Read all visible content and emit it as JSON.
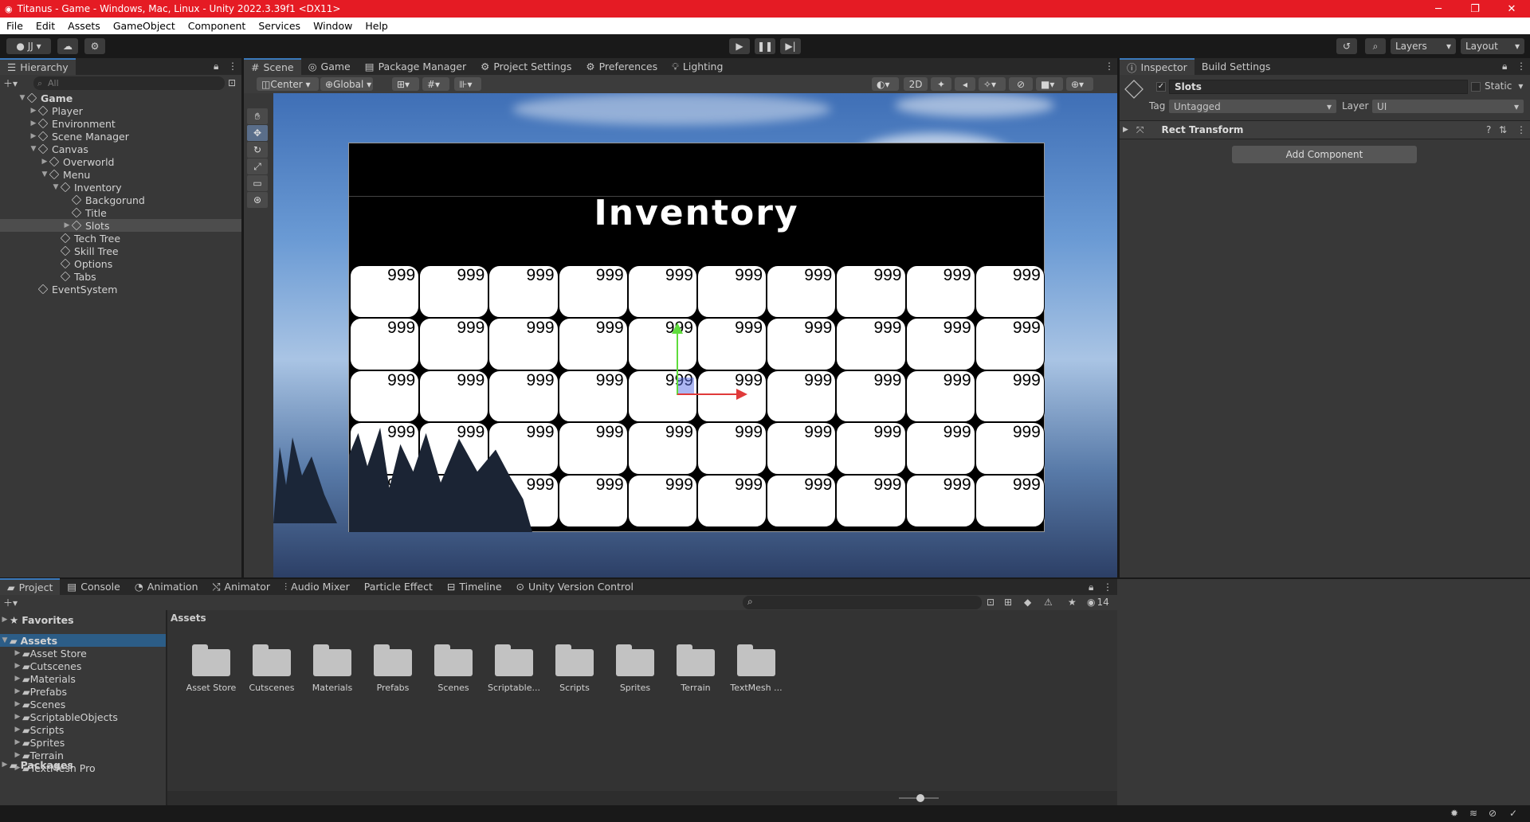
{
  "window": {
    "title": "Titanus - Game - Windows, Mac, Linux - Unity 2022.3.39f1 <DX11>",
    "minimize": "─",
    "maximize": "❐",
    "close": "✕"
  },
  "menu": [
    "File",
    "Edit",
    "Assets",
    "GameObject",
    "Component",
    "Services",
    "Window",
    "Help"
  ],
  "toolbar": {
    "account": "JJ",
    "layers": "Layers",
    "layout": "Layout"
  },
  "hierarchy": {
    "tab": "Hierarchy",
    "search_placeholder": "All",
    "rows": [
      {
        "label": "Game",
        "indent": 0,
        "arrow": "▼",
        "bold": true
      },
      {
        "label": "Player",
        "indent": 1,
        "arrow": "▶"
      },
      {
        "label": "Environment",
        "indent": 1,
        "arrow": "▶"
      },
      {
        "label": "Scene Manager",
        "indent": 1,
        "arrow": "▶"
      },
      {
        "label": "Canvas",
        "indent": 1,
        "arrow": "▼"
      },
      {
        "label": "Overworld",
        "indent": 2,
        "arrow": "▶"
      },
      {
        "label": "Menu",
        "indent": 2,
        "arrow": "▼"
      },
      {
        "label": "Inventory",
        "indent": 3,
        "arrow": "▼"
      },
      {
        "label": "Backgorund",
        "indent": 4,
        "arrow": ""
      },
      {
        "label": "Title",
        "indent": 4,
        "arrow": ""
      },
      {
        "label": "Slots",
        "indent": 4,
        "arrow": "▶",
        "selected": true
      },
      {
        "label": "Tech Tree",
        "indent": 3,
        "arrow": ""
      },
      {
        "label": "Skill Tree",
        "indent": 3,
        "arrow": ""
      },
      {
        "label": "Options",
        "indent": 3,
        "arrow": ""
      },
      {
        "label": "Tabs",
        "indent": 3,
        "arrow": ""
      },
      {
        "label": "EventSystem",
        "indent": 1,
        "arrow": ""
      }
    ]
  },
  "scene_tabs": [
    "Scene",
    "Game",
    "Package Manager",
    "Project Settings",
    "Preferences",
    "Lighting"
  ],
  "scene_toolbar": {
    "pivot": "Center",
    "space": "Global",
    "mode2d": "2D"
  },
  "game_view": {
    "title": "Inventory",
    "slot_value": "999",
    "rows": 5,
    "cols": 10
  },
  "inspector": {
    "tabs": [
      "Inspector",
      "Build Settings"
    ],
    "object_name": "Slots",
    "static_label": "Static",
    "tag_label": "Tag",
    "tag_value": "Untagged",
    "layer_label": "Layer",
    "layer_value": "UI",
    "component": "Rect Transform",
    "add_component": "Add Component"
  },
  "bottom_tabs": [
    "Project",
    "Console",
    "Animation",
    "Animator",
    "Audio Mixer",
    "Particle Effect",
    "Timeline",
    "Unity Version Control"
  ],
  "project": {
    "favorites": "Favorites",
    "assets_root": "Assets",
    "packages": "Packages",
    "tree": [
      "Asset Store",
      "Cutscenes",
      "Materials",
      "Prefabs",
      "Scenes",
      "ScriptableObjects",
      "Scripts",
      "Sprites",
      "Terrain",
      "TextMesh Pro"
    ],
    "breadcrumb": "Assets",
    "folders": [
      "Asset Store",
      "Cutscenes",
      "Materials",
      "Prefabs",
      "Scenes",
      "Scriptable...",
      "Scripts",
      "Sprites",
      "Terrain",
      "TextMesh ..."
    ],
    "hidden_count": "14"
  }
}
